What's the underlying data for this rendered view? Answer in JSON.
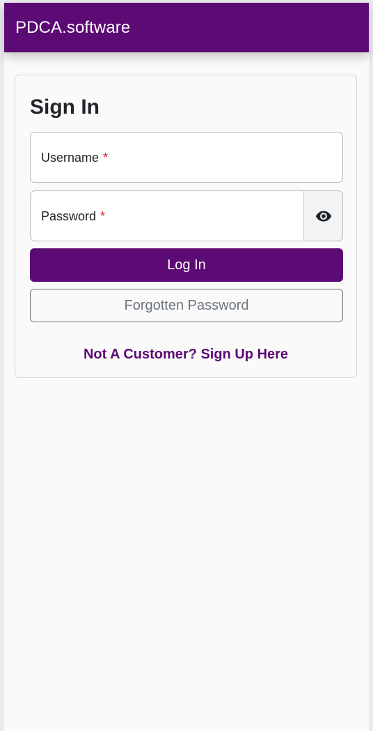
{
  "navbar": {
    "brand": "PDCA.software"
  },
  "signin": {
    "title": "Sign In",
    "username": {
      "label": "Username",
      "required_mark": "*"
    },
    "password": {
      "label": "Password",
      "required_mark": "*",
      "toggle_icon": "eye-icon"
    },
    "login_label": "Log In",
    "forgot_label": "Forgotten Password",
    "signup_label": "Not A Customer? Sign Up Here"
  },
  "colors": {
    "brand": "#5c0a74",
    "required": "#dc1f2e",
    "secondary": "#6c757d"
  }
}
